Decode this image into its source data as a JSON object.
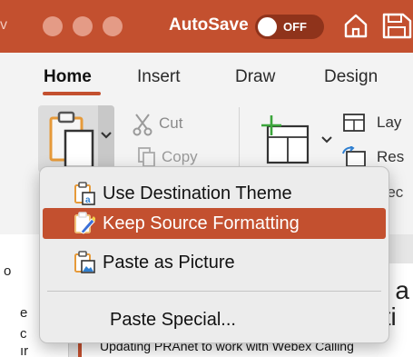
{
  "titlebar": {
    "edge_char": "v",
    "autosave_label": "AutoSave",
    "toggle_state": "OFF",
    "icons": [
      "home-icon",
      "save-icon"
    ]
  },
  "tabs": [
    {
      "label": "Home",
      "active": true
    },
    {
      "label": "Insert",
      "active": false
    },
    {
      "label": "Draw",
      "active": false
    },
    {
      "label": "Design",
      "active": false
    }
  ],
  "clipboard": {
    "cut_label": "Cut",
    "copy_label": "Copy"
  },
  "slides_group": {
    "layout_label": "Lay",
    "reset_label": "Res",
    "section_label": "Sec"
  },
  "paste_menu": {
    "items": [
      {
        "label": "Use Destination Theme",
        "icon": "paste-destination-theme-icon",
        "highlighted": false
      },
      {
        "label": "Keep Source Formatting",
        "icon": "paste-keep-formatting-icon",
        "highlighted": true
      },
      {
        "label": "Paste as Picture",
        "icon": "paste-as-picture-icon",
        "highlighted": false
      },
      {
        "label": "Paste Special...",
        "icon": "",
        "highlighted": false
      }
    ]
  },
  "background": {
    "pane_chars": [
      "o",
      "e",
      "c",
      "ır"
    ],
    "slide_fragment_1": "h a",
    "slide_fragment_2": "ıti",
    "slide_subtitle": "Updating PRAnet to work with Webex Calling"
  },
  "colors": {
    "accent": "#c3502f",
    "menu_bg": "#ececec",
    "ribbon_bg": "#f3f3f3"
  }
}
